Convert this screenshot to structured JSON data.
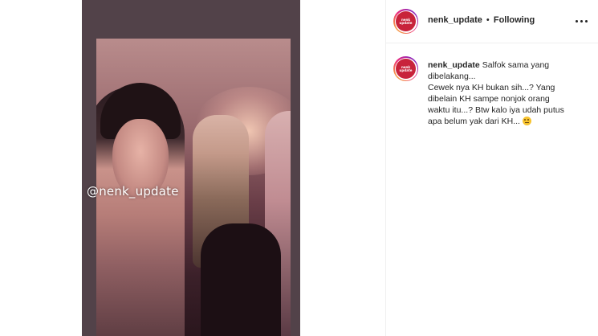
{
  "post": {
    "username": "nenk_update",
    "separator": "•",
    "follow_status": "Following",
    "avatar_text": "nenk update"
  },
  "media": {
    "watermark": "@nenk_update"
  },
  "caption": {
    "username": "nenk_update",
    "lines": [
      "Salfok sama yang",
      "dibelakang...",
      "Cewek nya KH bukan sih...? Yang",
      "dibelain KH sampe nonjok orang",
      "waktu itu...? Btw kalo iya udah putus",
      "apa belum yak dari KH..."
    ]
  },
  "icons": {
    "more": "more-options-icon",
    "emoji": "thinking-face-emoji-icon"
  },
  "colors": {
    "avatar_ring": "#ee2a7b",
    "text": "#262626",
    "divider": "#efefef"
  }
}
